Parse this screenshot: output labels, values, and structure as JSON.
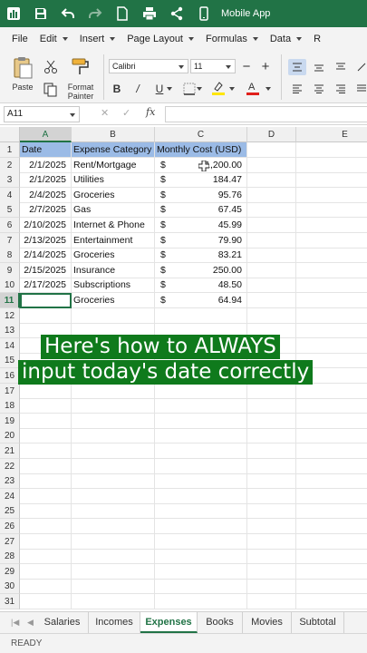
{
  "titlebar": {
    "app_title": "Mobile App"
  },
  "menu": {
    "items": [
      {
        "label": "File",
        "dropdown": false
      },
      {
        "label": "Edit",
        "dropdown": true
      },
      {
        "label": "Insert",
        "dropdown": true
      },
      {
        "label": "Page Layout",
        "dropdown": true
      },
      {
        "label": "Formulas",
        "dropdown": true
      },
      {
        "label": "Data",
        "dropdown": true
      },
      {
        "label": "R",
        "dropdown": false
      }
    ]
  },
  "ribbon": {
    "paste_label": "Paste",
    "format_painter_label": "Format\nPainter",
    "font_name": "Calibri",
    "font_size": "11",
    "bold": "B",
    "italic": "/",
    "underline": "U",
    "font_color": "#e0201b",
    "highlight_color": "#ffe600"
  },
  "formula_bar": {
    "name_box": "A11",
    "fx": "fx",
    "formula": ""
  },
  "sheet": {
    "columns": [
      "A",
      "B",
      "C",
      "D",
      "E"
    ],
    "active_column": "A",
    "active_row": 11,
    "rows": [
      {
        "n": "1",
        "a": "Date",
        "b": "Expense Category",
        "c_sym": "Monthly Cost (USD)",
        "c_val": ""
      },
      {
        "n": "2",
        "a": "2/1/2025",
        "b": "Rent/Mortgage",
        "c_sym": "$",
        "c_val": "1,200.00"
      },
      {
        "n": "3",
        "a": "2/1/2025",
        "b": "Utilities",
        "c_sym": "$",
        "c_val": "184.47"
      },
      {
        "n": "4",
        "a": "2/4/2025",
        "b": "Groceries",
        "c_sym": "$",
        "c_val": "95.76"
      },
      {
        "n": "5",
        "a": "2/7/2025",
        "b": "Gas",
        "c_sym": "$",
        "c_val": "67.45"
      },
      {
        "n": "6",
        "a": "2/10/2025",
        "b": "Internet & Phone",
        "c_sym": "$",
        "c_val": "45.99"
      },
      {
        "n": "7",
        "a": "2/13/2025",
        "b": "Entertainment",
        "c_sym": "$",
        "c_val": "79.90"
      },
      {
        "n": "8",
        "a": "2/14/2025",
        "b": "Groceries",
        "c_sym": "$",
        "c_val": "83.21"
      },
      {
        "n": "9",
        "a": "2/15/2025",
        "b": "Insurance",
        "c_sym": "$",
        "c_val": "250.00"
      },
      {
        "n": "10",
        "a": "2/17/2025",
        "b": "Subscriptions",
        "c_sym": "$",
        "c_val": "48.50"
      },
      {
        "n": "11",
        "a": "",
        "b": "Groceries",
        "c_sym": "$",
        "c_val": "64.94"
      },
      {
        "n": "12"
      },
      {
        "n": "13"
      },
      {
        "n": "14"
      },
      {
        "n": "15"
      },
      {
        "n": "16"
      },
      {
        "n": "17"
      },
      {
        "n": "18"
      },
      {
        "n": "19"
      },
      {
        "n": "20"
      },
      {
        "n": "21"
      },
      {
        "n": "22"
      },
      {
        "n": "23"
      },
      {
        "n": "24"
      },
      {
        "n": "25"
      },
      {
        "n": "26"
      },
      {
        "n": "27"
      },
      {
        "n": "28"
      },
      {
        "n": "29"
      },
      {
        "n": "30"
      },
      {
        "n": "31"
      }
    ]
  },
  "overlay": {
    "line1": "Here's how to ALWAYS",
    "line2": "input today's date correctly"
  },
  "tabs": {
    "items": [
      "Salaries",
      "Incomes",
      "Expenses",
      "Books",
      "Movies",
      "Subtotal"
    ],
    "active": "Expenses"
  },
  "status": {
    "text": "READY"
  },
  "colors": {
    "accent": "#217346",
    "header_fill": "#9bbbe6",
    "caption_bg": "#0f7a1c"
  }
}
